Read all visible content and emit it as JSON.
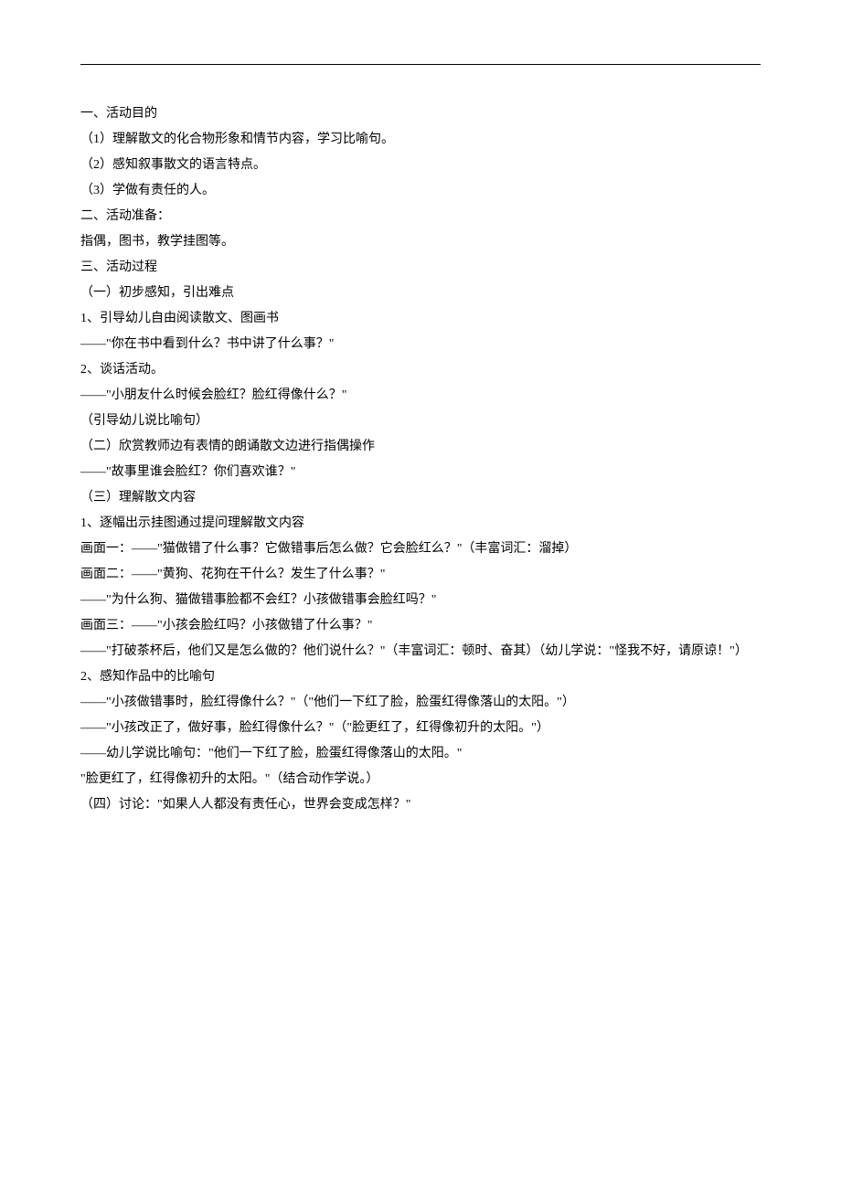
{
  "lines": [
    "一、活动目的",
    "（1）理解散文的化合物形象和情节内容，学习比喻句。",
    "（2）感知叙事散文的语言特点。",
    "（3）学做有责任的人。",
    "二、活动准备：",
    "指偶，图书，教学挂图等。",
    "三、活动过程",
    "（一）初步感知，引出难点",
    "1、引导幼儿自由阅读散文、图画书",
    "——\"你在书中看到什么？书中讲了什么事？\"",
    "2、谈话活动。",
    "——\"小朋友什么时候会脸红？脸红得像什么？\"",
    "（引导幼儿说比喻句）",
    "（二）欣赏教师边有表情的朗诵散文边进行指偶操作",
    "——\"故事里谁会脸红？你们喜欢谁？\"",
    "（三）理解散文内容",
    "1、逐幅出示挂图通过提问理解散文内容",
    "画面一：——\"猫做错了什么事？它做错事后怎么做？它会脸红么？\"（丰富词汇：溜掉）",
    "画面二：——\"黄狗、花狗在干什么？发生了什么事？\"",
    "——\"为什么狗、猫做错事脸都不会红？小孩做错事会脸红吗？\"",
    "画面三：——\"小孩会脸红吗？小孩做错了什么事？\"",
    "——\"打破茶杯后，他们又是怎么做的？他们说什么？\"（丰富词汇：顿时、奋其）（幼儿学说：\"怪我不好，请原谅！\"）",
    "2、感知作品中的比喻句",
    "——\"小孩做错事时，脸红得像什么？\"（\"他们一下红了脸，脸蛋红得像落山的太阳。\"）",
    "——\"小孩改正了，做好事，脸红得像什么？\"（\"脸更红了，红得像初升的太阳。\"）",
    "——幼儿学说比喻句：\"他们一下红了脸，脸蛋红得像落山的太阳。\"",
    "\"脸更红了，红得像初升的太阳。\"（结合动作学说。）",
    "（四）讨论：\"如果人人都没有责任心，世界会变成怎样？\""
  ]
}
